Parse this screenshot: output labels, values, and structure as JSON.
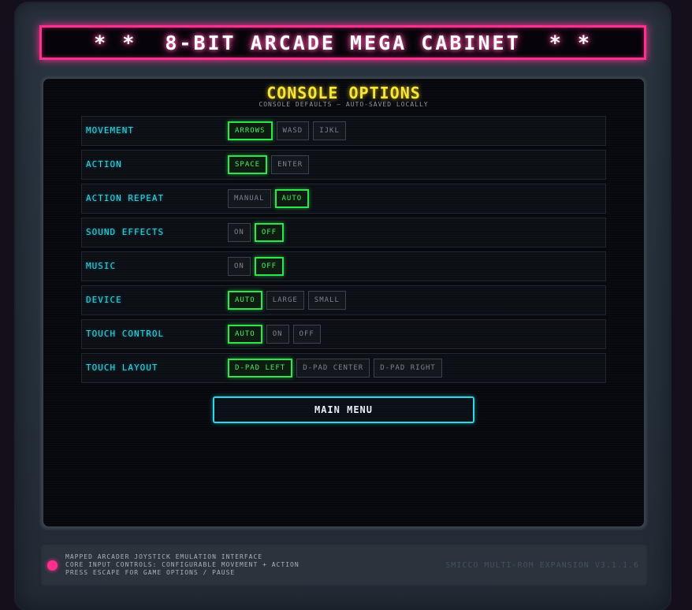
{
  "marquee": {
    "title": "* *  8-BIT ARCADE MEGA CABINET  * *"
  },
  "panel": {
    "title": "CONSOLE OPTIONS",
    "subtitle": "CONSOLE DEFAULTS — AUTO-SAVED LOCALLY"
  },
  "options": [
    {
      "label": "MOVEMENT",
      "choices": [
        "ARROWS",
        "WASD",
        "IJKL"
      ],
      "selected": "ARROWS"
    },
    {
      "label": "ACTION",
      "choices": [
        "SPACE",
        "ENTER"
      ],
      "selected": "SPACE"
    },
    {
      "label": "ACTION REPEAT",
      "choices": [
        "MANUAL",
        "AUTO"
      ],
      "selected": "AUTO"
    },
    {
      "label": "SOUND EFFECTS",
      "choices": [
        "ON",
        "OFF"
      ],
      "selected": "OFF"
    },
    {
      "label": "MUSIC",
      "choices": [
        "ON",
        "OFF"
      ],
      "selected": "OFF"
    },
    {
      "label": "DEVICE",
      "choices": [
        "AUTO",
        "LARGE",
        "SMALL"
      ],
      "selected": "AUTO"
    },
    {
      "label": "TOUCH CONTROL",
      "choices": [
        "AUTO",
        "ON",
        "OFF"
      ],
      "selected": "AUTO"
    },
    {
      "label": "TOUCH LAYOUT",
      "choices": [
        "D-PAD LEFT",
        "D-PAD CENTER",
        "D-PAD RIGHT"
      ],
      "selected": "D-PAD LEFT"
    }
  ],
  "main_menu_label": "MAIN MENU",
  "footer": {
    "lines": [
      "MAPPED ARCADER JOYSTICK EMULATION INTERFACE",
      "CORE INPUT CONTROLS: CONFIGURABLE MOVEMENT + ACTION",
      "PRESS ESCAPE FOR GAME OPTIONS / PAUSE"
    ],
    "version": "SMICCO MULTI-ROM EXPANSION V3.1.1.6"
  },
  "colors": {
    "marquee_border": "#ff2f8f",
    "title_yellow": "#f7e43b",
    "label_cyan": "#2fd7e6",
    "selected_green": "#2ee34c",
    "led_pink": "#ff2f8f"
  }
}
